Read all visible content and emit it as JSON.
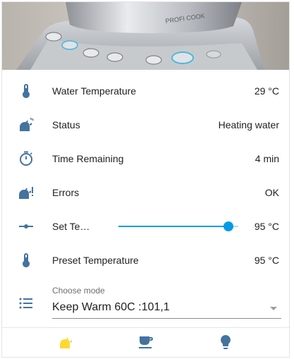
{
  "entities": {
    "water_temperature": {
      "label": "Water Temperature",
      "value": "29 °C",
      "icon": "thermometer-icon"
    },
    "status": {
      "label": "Status",
      "value": "Heating water",
      "icon": "kettle-steam-icon"
    },
    "time_remaining": {
      "label": "Time Remaining",
      "value": "4 min",
      "icon": "timer-icon"
    },
    "errors": {
      "label": "Errors",
      "value": "OK",
      "icon": "kettle-alert-icon"
    },
    "set_temperature": {
      "label": "Set Te…",
      "value": "95 °C",
      "slider_fraction": 0.92,
      "icon": "ray-vertex-icon"
    },
    "preset_temperature": {
      "label": "Preset Temperature",
      "value": "95 °C",
      "icon": "thermometer-icon"
    }
  },
  "mode": {
    "label": "Choose mode",
    "selected": "Keep Warm 60C :101,1",
    "icon": "format-list-bulleted-icon"
  },
  "footer": {
    "buttons": [
      {
        "icon": "kettle-icon",
        "color": "#fdd835"
      },
      {
        "icon": "coffee-icon",
        "color": "#44739e"
      },
      {
        "icon": "lightbulb-icon",
        "color": "#44739e"
      }
    ]
  },
  "colors": {
    "icon": "#44739e",
    "accent": "#039be5",
    "active": "#fdd835",
    "text": "#212121"
  }
}
